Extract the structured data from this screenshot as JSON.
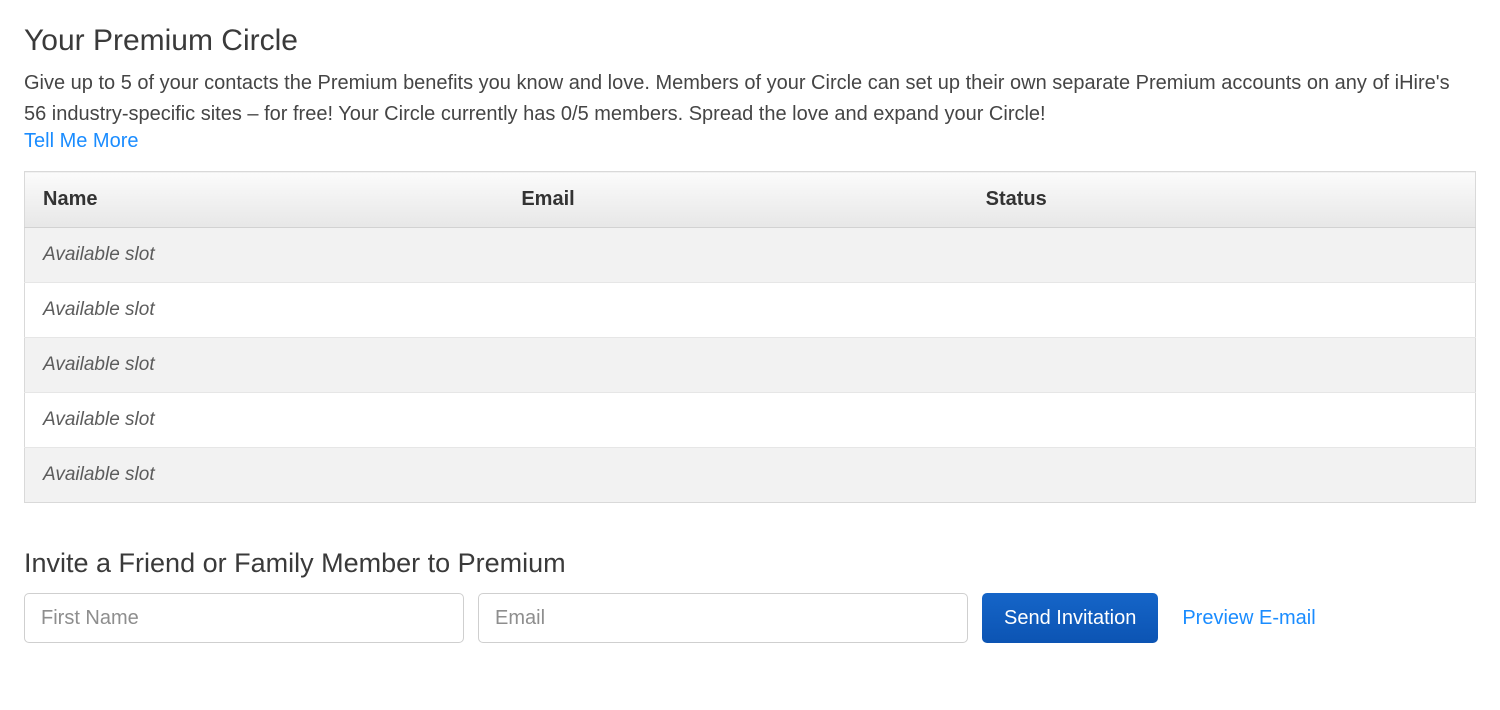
{
  "header": {
    "title": "Your Premium Circle",
    "description": "Give up to 5 of your contacts the Premium benefits you know and love. Members of your Circle can set up their own separate Premium accounts on any of iHire's 56 industry-specific sites – for free! Your Circle currently has 0/5 members. Spread the love and expand your Circle!",
    "tell_me_more": "Tell Me More"
  },
  "table": {
    "columns": [
      "Name",
      "Email",
      "Status"
    ],
    "rows": [
      {
        "name": "Available slot",
        "email": "",
        "status": ""
      },
      {
        "name": "Available slot",
        "email": "",
        "status": ""
      },
      {
        "name": "Available slot",
        "email": "",
        "status": ""
      },
      {
        "name": "Available slot",
        "email": "",
        "status": ""
      },
      {
        "name": "Available slot",
        "email": "",
        "status": ""
      }
    ]
  },
  "invite": {
    "heading": "Invite a Friend or Family Member to Premium",
    "first_name_placeholder": "First Name",
    "email_placeholder": "Email",
    "send_button": "Send Invitation",
    "preview_link": "Preview E-mail"
  }
}
